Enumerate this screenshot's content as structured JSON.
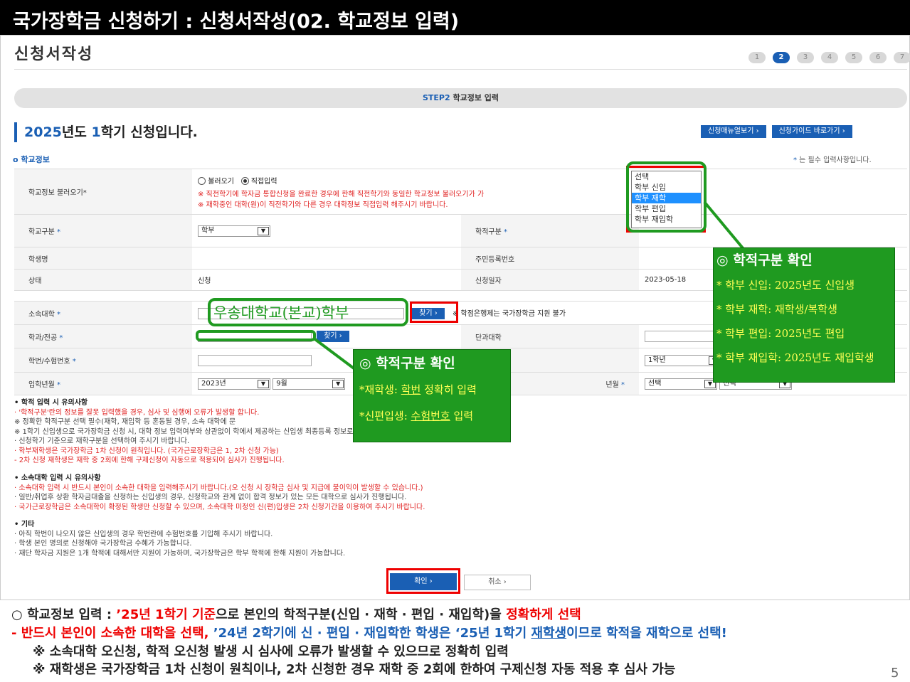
{
  "slide_title": "국가장학금 신청하기 : 신청서작성(02. 학교정보 입력)",
  "page_heading": "신청서작성",
  "steps": [
    "1",
    "2",
    "3",
    "4",
    "5",
    "6",
    "7"
  ],
  "step_bar": {
    "step": "STEP2",
    "label": "학교정보 입력"
  },
  "semester": {
    "year": "2025",
    "year_suffix": "년도 ",
    "term": "1",
    "term_suffix": "학기 신청입니다."
  },
  "top_buttons": {
    "manual": "신청매뉴얼보기  ›",
    "guide": "신청가이드 바로가기  ›"
  },
  "section_label": "o 학교정보",
  "required_note": {
    "star": "*",
    "text": " 는 필수 입력사항입니다."
  },
  "form": {
    "load_label": "학교정보 불러오기*",
    "radio_load": "불러오기",
    "radio_direct": "직접입력",
    "warn1": "※ 직전학기에 학자금 통합신청을 완료한 경우에 한해 직전학기와 동일한 학교정보 불러오기가 가",
    "warn2": "※ 재학중인 대학(원)이 직전학기와 다른 경우 대학정보 직접입력 해주시기 바랍니다.",
    "school_type_label": "학교구분",
    "school_type_value": "학부",
    "enroll_type_label": "학적구분",
    "student_name_label": "학생명",
    "resident_no_label": "주민등록번호",
    "status_label": "상태",
    "status_value": "신청",
    "apply_date_label": "신청일자",
    "apply_date_value": "2023-05-18",
    "univ_label": "소속대학",
    "find_button": "찾기 ›",
    "univ_note": "※ 학점은행제는 국가장학금 지원 불가",
    "dept_label": "학과/전공",
    "college_label": "단과대학",
    "student_no_label": "학번/수험번호",
    "grade_value": "1학년",
    "admission_label": "입학년월",
    "admission_year": "2023년",
    "admission_month": "9월",
    "grad_label_suffix": "년월",
    "grad_select": "선택",
    "grad_select2": "선택"
  },
  "dropdown_options": [
    "선택",
    "학부 신입",
    "학부 재학",
    "학부 편입",
    "학부 재입학"
  ],
  "univ_entered": "우송대학교(본교)학부",
  "callout_right": {
    "title": "◎ 학적구분 확인",
    "items": [
      "* 학부 신입: 2025년도 신입생",
      "* 학부 재학: 재학생/복학생",
      "* 학부 편입: 2025년도 편입",
      "* 학부 재입학: 2025년도 재입학생"
    ]
  },
  "callout_mid": {
    "title": "◎ 학적구분 확인",
    "item1_a": "*재학생: ",
    "item1_u": "학번",
    "item1_b": " 정확히 입력",
    "item2_a": "*신편입생: ",
    "item2_u": "수험번호",
    "item2_b": " 입력"
  },
  "notes1": {
    "title": "• 학적 입력 시 유의사항",
    "l1": "· '학적구분'란의 정보를 잘못 입력했을 경우, 심사 및 심행에 오류가 발생할                                              합니다.",
    "l2": "  ※ 정확한 학적구분 선택 필수(재학, 재입학 등 혼동될 경우, 소속 대학에 문",
    "l3": "  ※ 1학기 신입생으로 국가장학금 신청 시, 대학 정보 입력여부와 상관없이                                              학에서 제공하는 신입생 최종등록 정보로 심사 진행됩니다.",
    "l4": "· 신청학기 기준으로 재학구분을 선택하여 주시기 바랍니다.",
    "l5": "· 학부재학생은 국가장학금 1차 신청이 원칙입니다. (국가근로장학금은 1, 2차 신청 가능)",
    "l6": "  - 2차 신청 재학생은 재학 중 2회에 한해 구제신청이 자동으로 적용되어 심사가 진행됩니다."
  },
  "notes2": {
    "title": "• 소속대학 입력 시 유의사항",
    "l1": "· 소속대학 입력 시 반드시 본인이 소속한 대학을 입력해주시기 바랍니다.(오 신청 시 장학금 심사 및 지급에 불이익이 발생할 수 있습니다.)",
    "l2": "· 일반/취업후 상환 학자금대출을 신청하는 신입생의 경우, 신청학교와 관계 없이 합격 정보가 있는 모든 대학으로 심사가 진행됩니다.",
    "l3": "· 국가근로장학금은 소속대학이 확정된 학생만 신청할 수 있으며, 소속대학 미정인 신(편)입생은 2차 신청기간을 이용하여 주시기 바랍니다."
  },
  "notes3": {
    "title": "• 기타",
    "l1": "· 아직 학번이 나오지 않은 신입생의 경우 학번란에 수험번호를 기입해 주시기 바랍니다.",
    "l2": "· 학생 본인 명의로 신청해야 국가장학금 수혜가 가능합니다.",
    "l3": "· 재단 학자금 지원은 1개 학적에 대해서만 지원이 가능하며, 국가장학금은 학부 학적에 한해 지원이 가능합니다."
  },
  "confirm_button": "확인      ›",
  "cancel_button": "취소      ›",
  "summary": {
    "line1_a": "○ 학교정보 입력 : ",
    "line1_b": "’25년 1학기 기준",
    "line1_c": "으로 본인의 학적구분(신입 · 재학 · 편입 · 재입학)을 ",
    "line1_d": "정확하게 선택",
    "line2_a": " - 반드시 본인이 소속한 대학을 선택, ",
    "line2_b": "’24년 2학기에 신 · 편입 · 재입학한 학생은 ‘25년 1학기 ",
    "line2_u": "재학생",
    "line2_c": "이므로 학적을 재학으로 선택!",
    "line3": "※ 소속대학 오신청, 학적 오신청 발생 시 심사에 오류가 발생할 수 있으므로 정확히 입력",
    "line4": "※ 재학생은 국가장학금 1차 신청이 원칙이나, 2차 신청한 경우 재학 중 2회에 한하여 구제신청 자동 적용 후 심사 가능"
  },
  "page_number": "5"
}
